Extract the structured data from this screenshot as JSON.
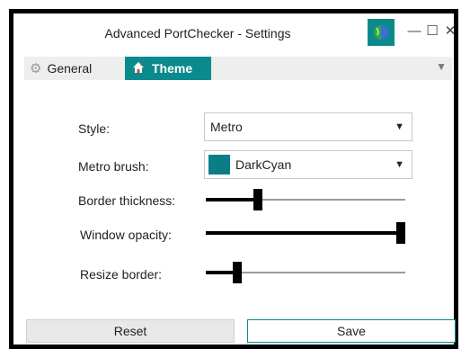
{
  "window": {
    "title": "Advanced PortChecker - Settings"
  },
  "controls": {
    "minimize": "—",
    "maximize": "☐",
    "close": "✕"
  },
  "tabs": [
    {
      "label": "General",
      "icon": "gear-icon",
      "active": false
    },
    {
      "label": "Theme",
      "icon": "home-icon",
      "active": true
    }
  ],
  "settings": {
    "style": {
      "label": "Style:",
      "value": "Metro"
    },
    "brush": {
      "label": "Metro brush:",
      "value": "DarkCyan",
      "color": "#0b7d86"
    },
    "border_thickness": {
      "label": "Border thickness:",
      "level": 0.25
    },
    "window_opacity": {
      "label": "Window opacity:",
      "level": 1.0
    },
    "resize_border": {
      "label": "Resize border:",
      "level": 0.14
    }
  },
  "buttons": {
    "reset": "Reset",
    "save": "Save"
  },
  "colors": {
    "accent": "#0b8a8e"
  }
}
